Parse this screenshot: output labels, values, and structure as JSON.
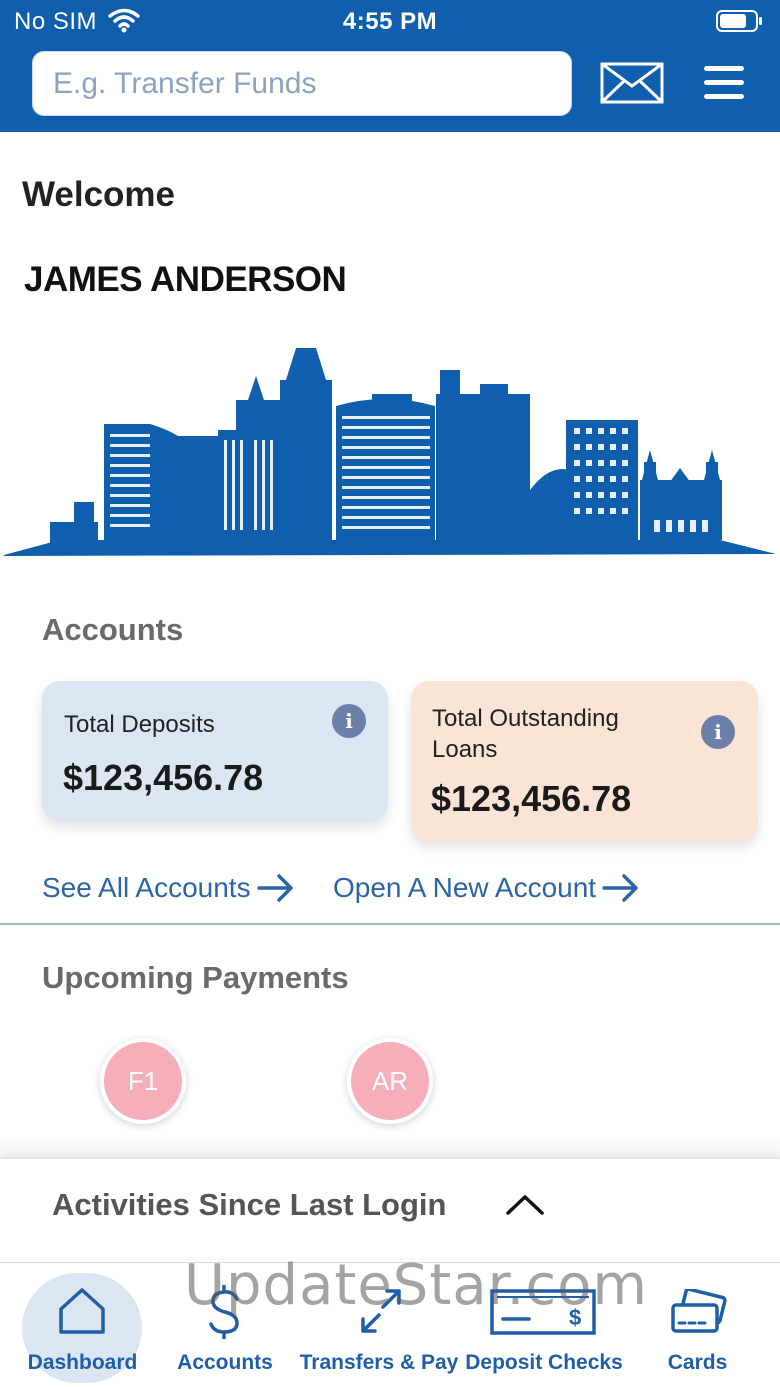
{
  "status_bar": {
    "carrier": "No SIM",
    "time": "4:55 PM",
    "icons": [
      "wifi-icon",
      "battery-icon"
    ]
  },
  "header": {
    "search_placeholder": "E.g. Transfer Funds",
    "icons": [
      "mail-icon",
      "hamburger-menu-icon"
    ],
    "background_color": "#0f5fae"
  },
  "welcome": {
    "greeting": "Welcome",
    "user_name": "JAMES ANDERSON"
  },
  "accounts": {
    "title": "Accounts",
    "total_deposits": {
      "label": "Total Deposits",
      "amount": "$123,456.78",
      "color": "#dce6f2"
    },
    "total_outstanding_loans": {
      "label_line1": "Total Outstanding",
      "label_line2": "Loans",
      "amount": "$123,456.78",
      "color": "#fbe3d6"
    },
    "see_all_link": "See All Accounts",
    "open_new_link": "Open A New Account"
  },
  "upcoming_payments": {
    "title": "Upcoming Payments",
    "payees": [
      {
        "initials": "F1"
      },
      {
        "initials": "AR"
      }
    ]
  },
  "activities": {
    "title": "Activities Since Last Login",
    "icon": "chevron-up-icon"
  },
  "bottom_nav": {
    "items": [
      {
        "label": "Dashboard",
        "icon": "home-icon",
        "active": true
      },
      {
        "label": "Accounts",
        "icon": "dollar-icon",
        "active": false
      },
      {
        "label": "Transfers & Pay",
        "icon": "transfer-arrows-icon",
        "active": false
      },
      {
        "label": "Deposit Checks",
        "icon": "check-icon",
        "active": false
      },
      {
        "label": "Cards",
        "icon": "credit-card-icon",
        "active": false
      }
    ],
    "accent_color": "#1f5fa8"
  },
  "watermark": "UpdateStar.com"
}
